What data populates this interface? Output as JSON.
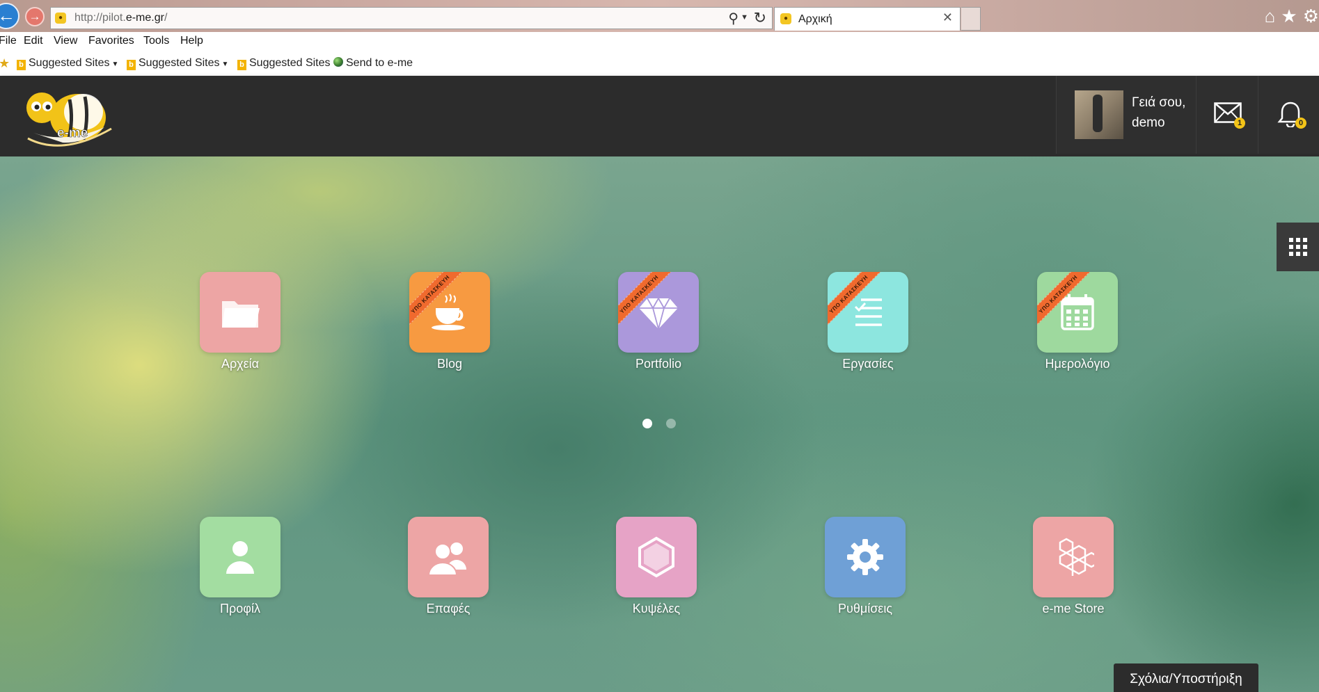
{
  "browser": {
    "url_prefix": "http://pilot.",
    "url_domain": "e-me.gr",
    "url_suffix": "/",
    "tab_title": "Αρχική",
    "menu": [
      "File",
      "Edit",
      "View",
      "Favorites",
      "Tools",
      "Help"
    ],
    "favorites": [
      {
        "label": "Suggested Sites",
        "dropdown": true
      },
      {
        "label": "Suggested Sites",
        "dropdown": true
      },
      {
        "label": "Suggested Sites",
        "dropdown": false
      },
      {
        "label": "Send to e-me",
        "dropdown": false
      }
    ]
  },
  "header": {
    "logo_text": "e-me",
    "greeting_line1": "Γειά σου,",
    "greeting_line2": "demo",
    "mail_count": "1",
    "notification_count": "0"
  },
  "apps_row1": [
    {
      "label": "Αρχεία",
      "color": "#eda5a4",
      "icon": "folder-icon",
      "ribbon": ""
    },
    {
      "label": "Blog",
      "color": "#f79a41",
      "icon": "coffee-cup-icon",
      "ribbon": "ΥΠΟ ΚΑΤΑΣΚΕΥΗ"
    },
    {
      "label": "Portfolio",
      "color": "#ab98db",
      "icon": "diamond-icon",
      "ribbon": "ΥΠΟ ΚΑΤΑΣΚΕΥΗ"
    },
    {
      "label": "Εργασίες",
      "color": "#8de6df",
      "icon": "checklist-icon",
      "ribbon": "ΥΠΟ ΚΑΤΑΣΚΕΥΗ"
    },
    {
      "label": "Ημερολόγιο",
      "color": "#9ed99e",
      "icon": "calendar-icon",
      "ribbon": "ΥΠΟ ΚΑΤΑΣΚΕΥΗ"
    }
  ],
  "apps_row2": [
    {
      "label": "Προφίλ",
      "color": "#a3dda1",
      "icon": "user-icon"
    },
    {
      "label": "Επαφές",
      "color": "#eda5a5",
      "icon": "contacts-icon"
    },
    {
      "label": "Κυψέλες",
      "color": "#e6a3c6",
      "icon": "hexagon-icon"
    },
    {
      "label": "Ρυθμίσεις",
      "color": "#6fa0d6",
      "icon": "gear-icon"
    },
    {
      "label": "e-me Store",
      "color": "#eda5a5",
      "icon": "honeycomb-icon"
    }
  ],
  "pager": {
    "pages": 2,
    "current": 1
  },
  "feedback_label": "Σχόλια/Υποστήριξη"
}
